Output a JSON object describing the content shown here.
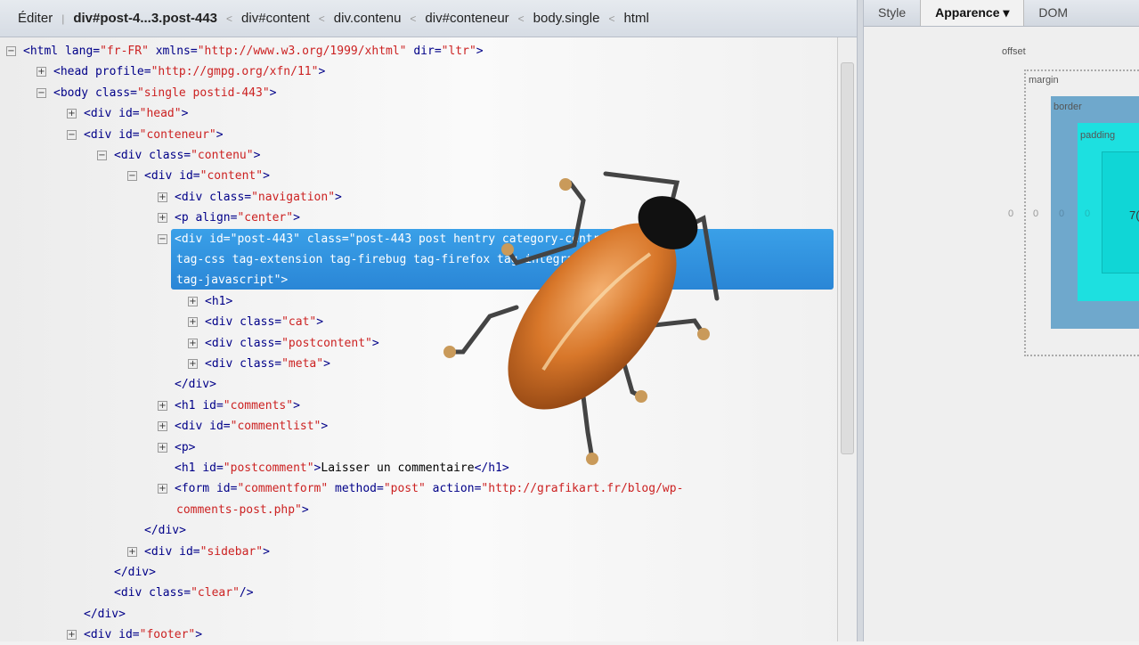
{
  "breadcrumb": {
    "edit_label": "Éditer",
    "items": [
      "div#post-4...3.post-443",
      "div#content",
      "div.contenu",
      "div#conteneur",
      "body.single",
      "html"
    ],
    "separator": "<"
  },
  "side_tabs": [
    {
      "label": "Style"
    },
    {
      "label": "Apparence ▾"
    },
    {
      "label": "DOM"
    }
  ],
  "box_model": {
    "offset_label": "offset",
    "margin_label": "margin",
    "border_label": "border",
    "padding_label": "padding",
    "values": [
      "0",
      "0",
      "0",
      "0"
    ],
    "content_value": "7(",
    "colors": {
      "border": "#6fa8cc",
      "padding": "#1de0e0",
      "content": "#10d6d6"
    }
  },
  "code_lines": [
    {
      "lvl": 0,
      "tog": "-",
      "segs": [
        [
          "tag",
          "<html "
        ],
        [
          "attr",
          "lang="
        ],
        [
          "val",
          "\"fr-FR\""
        ],
        [
          "attr",
          " xmlns="
        ],
        [
          "val",
          "\"http://www.w3.org/1999/xhtml\""
        ],
        [
          "attr",
          " dir="
        ],
        [
          "val",
          "\"ltr\""
        ],
        [
          "tag",
          ">"
        ]
      ]
    },
    {
      "lvl": 1,
      "tog": "+",
      "segs": [
        [
          "tag",
          "<head "
        ],
        [
          "attr",
          "profile="
        ],
        [
          "val",
          "\"http://gmpg.org/xfn/11\""
        ],
        [
          "tag",
          ">"
        ]
      ]
    },
    {
      "lvl": 1,
      "tog": "-",
      "segs": [
        [
          "tag",
          "<body "
        ],
        [
          "attr",
          "class="
        ],
        [
          "val",
          "\"single postid-443\""
        ],
        [
          "tag",
          ">"
        ]
      ]
    },
    {
      "lvl": 2,
      "tog": "+",
      "segs": [
        [
          "tag",
          "<div "
        ],
        [
          "attr",
          "id="
        ],
        [
          "val",
          "\"head\""
        ],
        [
          "tag",
          ">"
        ]
      ]
    },
    {
      "lvl": 2,
      "tog": "-",
      "segs": [
        [
          "tag",
          "<div "
        ],
        [
          "attr",
          "id="
        ],
        [
          "val",
          "\"conteneur\""
        ],
        [
          "tag",
          ">"
        ]
      ]
    },
    {
      "lvl": 3,
      "tog": "-",
      "segs": [
        [
          "tag",
          "<div "
        ],
        [
          "attr",
          "class="
        ],
        [
          "val",
          "\"contenu\""
        ],
        [
          "tag",
          ">"
        ]
      ]
    },
    {
      "lvl": 4,
      "tog": "-",
      "segs": [
        [
          "tag",
          "<div "
        ],
        [
          "attr",
          "id="
        ],
        [
          "val",
          "\"content\""
        ],
        [
          "tag",
          ">"
        ]
      ]
    },
    {
      "lvl": 5,
      "tog": "+",
      "segs": [
        [
          "tag",
          "<div "
        ],
        [
          "attr",
          "class="
        ],
        [
          "val",
          "\"navigation\""
        ],
        [
          "tag",
          ">"
        ]
      ]
    },
    {
      "lvl": 5,
      "tog": "+",
      "segs": [
        [
          "tag",
          "<p "
        ],
        [
          "attr",
          "align="
        ],
        [
          "val",
          "\"center\""
        ],
        [
          "tag",
          ">"
        ]
      ]
    },
    {
      "lvl": 5,
      "tog": "-",
      "selected": true,
      "segs": [
        [
          "tag",
          "<div "
        ],
        [
          "attr",
          "id="
        ],
        [
          "val",
          "\"post-443\""
        ],
        [
          "attr",
          " class="
        ],
        [
          "val",
          "\"post-443 post hentry category-centre-du-web"
        ]
      ]
    },
    {
      "lvl": 5,
      "tog": "",
      "cont": true,
      "segs": [
        [
          "val",
          "tag-css tag-extension tag-firebug tag-firefox tag-integration"
        ]
      ]
    },
    {
      "lvl": 5,
      "tog": "",
      "cont": true,
      "segs": [
        [
          "val",
          "tag-javascript\""
        ],
        [
          "tag",
          ">"
        ]
      ]
    },
    {
      "lvl": 6,
      "tog": "+",
      "segs": [
        [
          "tag",
          "<h1>"
        ]
      ]
    },
    {
      "lvl": 6,
      "tog": "+",
      "segs": [
        [
          "tag",
          "<div "
        ],
        [
          "attr",
          "class="
        ],
        [
          "val",
          "\"cat\""
        ],
        [
          "tag",
          ">"
        ]
      ]
    },
    {
      "lvl": 6,
      "tog": "+",
      "segs": [
        [
          "tag",
          "<div "
        ],
        [
          "attr",
          "class="
        ],
        [
          "val",
          "\"postcontent\""
        ],
        [
          "tag",
          ">"
        ]
      ]
    },
    {
      "lvl": 6,
      "tog": "+",
      "segs": [
        [
          "tag",
          "<div "
        ],
        [
          "attr",
          "class="
        ],
        [
          "val",
          "\"meta\""
        ],
        [
          "tag",
          ">"
        ]
      ]
    },
    {
      "lvl": 5,
      "tog": "",
      "segs": [
        [
          "tag",
          "</div>"
        ]
      ]
    },
    {
      "lvl": 5,
      "tog": "+",
      "segs": [
        [
          "tag",
          "<h1 "
        ],
        [
          "attr",
          "id="
        ],
        [
          "val",
          "\"comments\""
        ],
        [
          "tag",
          ">"
        ]
      ]
    },
    {
      "lvl": 5,
      "tog": "+",
      "segs": [
        [
          "tag",
          "<div "
        ],
        [
          "attr",
          "id="
        ],
        [
          "val",
          "\"commentlist\""
        ],
        [
          "tag",
          ">"
        ]
      ]
    },
    {
      "lvl": 5,
      "tog": "+",
      "segs": [
        [
          "tag",
          "<p>"
        ]
      ]
    },
    {
      "lvl": 5,
      "tog": "",
      "segs": [
        [
          "tag",
          "<h1 "
        ],
        [
          "attr",
          "id="
        ],
        [
          "val",
          "\"postcomment\""
        ],
        [
          "tag",
          ">"
        ],
        [
          "txt",
          "Laisser un commentaire"
        ],
        [
          "tag",
          "</h1>"
        ]
      ]
    },
    {
      "lvl": 5,
      "tog": "+",
      "segs": [
        [
          "tag",
          "<form "
        ],
        [
          "attr",
          "id="
        ],
        [
          "val",
          "\"commentform\""
        ],
        [
          "attr",
          " method="
        ],
        [
          "val",
          "\"post\""
        ],
        [
          "attr",
          " action="
        ],
        [
          "val",
          "\"http://grafikart.fr/blog/wp-"
        ]
      ]
    },
    {
      "lvl": 5,
      "tog": "",
      "cont": true,
      "segs": [
        [
          "val",
          "comments-post.php\""
        ],
        [
          "tag",
          ">"
        ]
      ]
    },
    {
      "lvl": 4,
      "tog": "",
      "segs": [
        [
          "tag",
          "</div>"
        ]
      ]
    },
    {
      "lvl": 4,
      "tog": "+",
      "segs": [
        [
          "tag",
          "<div "
        ],
        [
          "attr",
          "id="
        ],
        [
          "val",
          "\"sidebar\""
        ],
        [
          "tag",
          ">"
        ]
      ]
    },
    {
      "lvl": 3,
      "tog": "",
      "segs": [
        [
          "tag",
          "</div>"
        ]
      ]
    },
    {
      "lvl": 3,
      "tog": "",
      "segs": [
        [
          "tag",
          "<div "
        ],
        [
          "attr",
          "class="
        ],
        [
          "val",
          "\"clear\""
        ],
        [
          "tag",
          "/>"
        ]
      ]
    },
    {
      "lvl": 2,
      "tog": "",
      "segs": [
        [
          "tag",
          "</div>"
        ]
      ]
    },
    {
      "lvl": 2,
      "tog": "+",
      "segs": [
        [
          "tag",
          "<div "
        ],
        [
          "attr",
          "id="
        ],
        [
          "val",
          "\"footer\""
        ],
        [
          "tag",
          ">"
        ]
      ]
    }
  ]
}
